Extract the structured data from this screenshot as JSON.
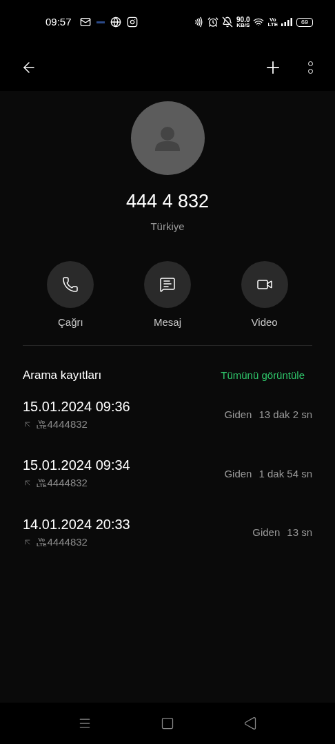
{
  "status_bar": {
    "time": "09:57",
    "speed": "90.0",
    "speed_unit": "KB/S",
    "volte_top": "Vo",
    "volte_bottom": "LTE",
    "battery": "69"
  },
  "contact": {
    "number": "444 4 832",
    "country": "Türkiye"
  },
  "actions": [
    {
      "kind": "call",
      "label": "Çağrı"
    },
    {
      "kind": "message",
      "label": "Mesaj"
    },
    {
      "kind": "video",
      "label": "Video"
    }
  ],
  "call_log": {
    "title": "Arama kayıtları",
    "view_all": "Tümünü görüntüle",
    "entries": [
      {
        "datetime": "15.01.2024 09:36",
        "network_top": "Vo",
        "network_bottom": "LTE",
        "number": "4444832",
        "type": "Giden",
        "duration": "13 dak 2 sn"
      },
      {
        "datetime": "15.01.2024 09:34",
        "network_top": "Vo",
        "network_bottom": "LTE",
        "number": "4444832",
        "type": "Giden",
        "duration": "1 dak 54 sn"
      },
      {
        "datetime": "14.01.2024 20:33",
        "network_top": "Vo",
        "network_bottom": "LTE",
        "number": "4444832",
        "type": "Giden",
        "duration": "13 sn"
      }
    ]
  }
}
